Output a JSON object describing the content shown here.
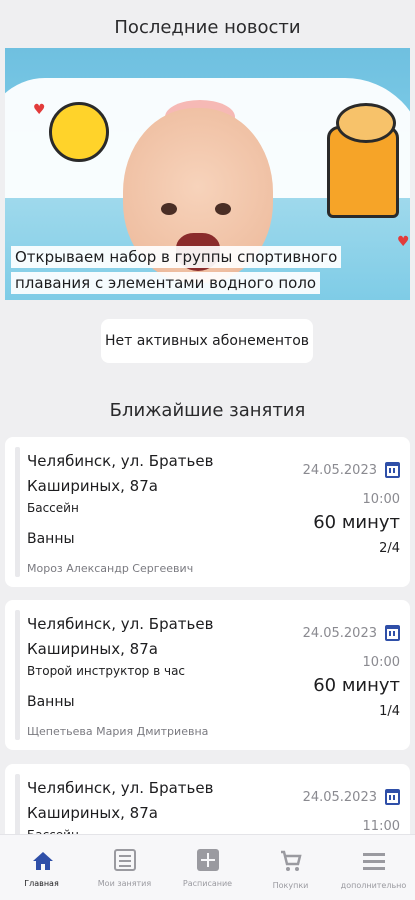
{
  "news": {
    "title": "Последние новости",
    "caption": "Открываем набор в группы спортивного плавания с элементами водного поло"
  },
  "subscriptions": {
    "label": "Нет активных абонементов"
  },
  "classes": {
    "title": "Ближайшие занятия",
    "items": [
      {
        "address": "Челябинск, ул. Братьев Кашириных, 87а",
        "service": "Бассейн",
        "room": "Ванны",
        "trainer": "Мороз Александр Сергеевич",
        "date": "24.05.2023",
        "time": "10:00",
        "duration": "60 минут",
        "slots": "2/4"
      },
      {
        "address": "Челябинск, ул. Братьев Кашириных, 87а",
        "service": "Второй инструктор в час",
        "room": "Ванны",
        "trainer": "Щепетьева Мария Дмитриевна",
        "date": "24.05.2023",
        "time": "10:00",
        "duration": "60 минут",
        "slots": "1/4"
      },
      {
        "address": "Челябинск, ул. Братьев Кашириных, 87а",
        "service": "Бассейн",
        "room": "",
        "trainer": "",
        "date": "24.05.2023",
        "time": "11:00",
        "duration": "",
        "slots": ""
      }
    ]
  },
  "nav": {
    "items": [
      {
        "label": "Главная",
        "icon": "home-icon",
        "active": true
      },
      {
        "label": "Мои занятия",
        "icon": "list-icon",
        "active": false
      },
      {
        "label": "Расписание",
        "icon": "add-schedule-icon",
        "active": false
      },
      {
        "label": "Покупки",
        "icon": "cart-icon",
        "active": false
      },
      {
        "label": "дополнительно",
        "icon": "menu-icon",
        "active": false
      }
    ]
  },
  "colors": {
    "accent": "#2f4fa8",
    "background": "#efeff1",
    "card": "#ffffff"
  }
}
